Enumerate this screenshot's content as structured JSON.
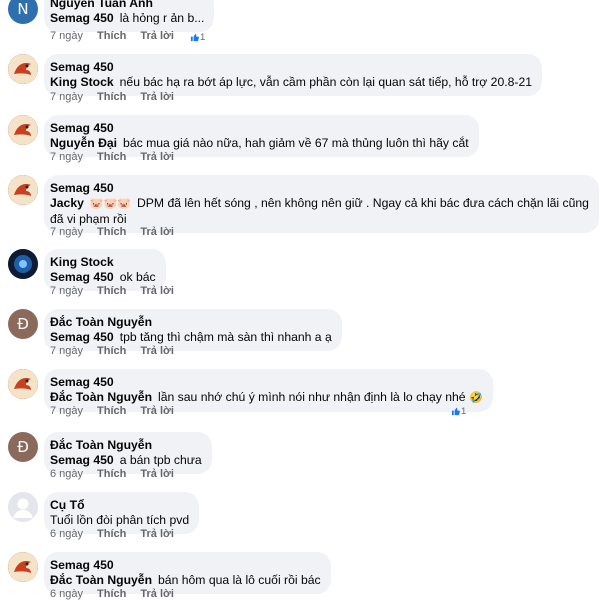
{
  "comments": [
    {
      "author": "Nguyễn Tuấn Anh",
      "avatar_letter": "N",
      "mention": "Semag 450",
      "text": "là hỏng r ản b...",
      "time": "7 ngày",
      "like": "Thích",
      "reply": "Trả lời",
      "reactions": "1"
    },
    {
      "author": "Semag 450",
      "mention": "King Stock",
      "text": "nếu bác hạ ra bớt áp lực, vẫn cầm phần còn lại quan sát tiếp, hỗ trợ 20.8-21",
      "time": "7 ngày",
      "like": "Thích",
      "reply": "Trả lời"
    },
    {
      "author": "Semag 450",
      "mention": "Nguyễn Đại",
      "text": "bác mua giá nào nữa, hah giảm về 67 mà thủng luôn thì hãy cắt",
      "time": "7 ngày",
      "like": "Thích",
      "reply": "Trả lời"
    },
    {
      "author": "Semag 450",
      "mention": "Jacky",
      "emojis": "🐷🐷🐷",
      "text": "DPM đã lên hết sóng , nên không nên giữ . Ngay cả khi bác đưa cách chặn lãi cũng",
      "text2": "đã vi phạm rồi",
      "time": "7 ngày",
      "like": "Thích",
      "reply": "Trả lời"
    },
    {
      "author": "King Stock",
      "mention": "Semag 450",
      "text": "ok bác",
      "time": "7 ngày",
      "like": "Thích",
      "reply": "Trả lời"
    },
    {
      "author": "Đắc Toàn Nguyễn",
      "avatar_letter": "Đ",
      "mention": "Semag 450",
      "text": "tpb tăng thì chậm mà sàn thì nhanh a ạ",
      "time": "7 ngày",
      "like": "Thích",
      "reply": "Trả lời"
    },
    {
      "author": "Semag 450",
      "mention": "Đắc Toàn Nguyễn",
      "text": "lần sau nhớ chú ý mình nói như nhận định là lo chạy nhé",
      "emoji_end": "🤣",
      "time": "7 ngày",
      "like": "Thích",
      "reply": "Trả lời",
      "reactions": "1"
    },
    {
      "author": "Đắc Toàn Nguyễn",
      "avatar_letter": "Đ",
      "mention": "Semag 450",
      "text": "a bán tpb chưa",
      "time": "6 ngày",
      "like": "Thích",
      "reply": "Trả lời"
    },
    {
      "author": "Cụ Tổ",
      "mention": "",
      "text": "Tuổi lồn đòi phân tích pvd",
      "time": "6 ngày",
      "like": "Thích",
      "reply": "Trả lời"
    },
    {
      "author": "Semag 450",
      "mention": "Đắc Toàn Nguyễn",
      "text": "bán hôm qua là lô cuối rồi bác",
      "time": "6 ngày",
      "like": "Thích",
      "reply": "Trả lời"
    }
  ],
  "colors": {
    "bubble": "#f0f2f5",
    "meta": "#65676b",
    "like_blue": "#1877f2"
  }
}
